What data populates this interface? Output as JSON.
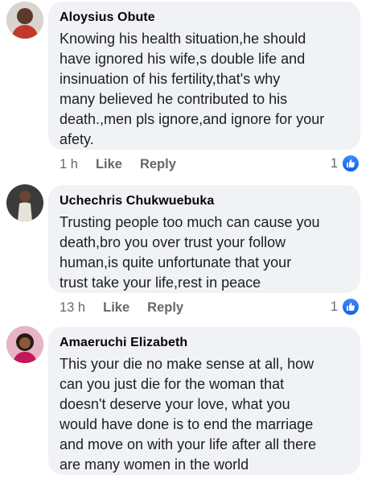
{
  "comments": [
    {
      "author": "Aloysius Obute",
      "text": "Knowing  his health situation,he should\nhave ignored his wife,s double life  and\ninsinuation  of his fertility,that's why\nmany believed he contributed to his\ndeath.,men pls ignore,and ignore for your\nafety.",
      "time": "1 h",
      "like_label": "Like",
      "reply_label": "Reply",
      "reaction_count": "1"
    },
    {
      "author": "Uchechris Chukwuebuka",
      "text": "Trusting people too much can cause you\ndeath,bro you over trust your follow\nhuman,is quite unfortunate that your\ntrust take your life,rest in peace",
      "time": "13 h",
      "like_label": "Like",
      "reply_label": "Reply",
      "reaction_count": "1"
    },
    {
      "author": "Amaeruchi Elizabeth",
      "text": "This your die no make sense at all, how\ncan you just die for the woman that\ndoesn't deserve your love, what you\nwould have done is to end the marriage\nand move on with your life after all there\nare many women in the world",
      "time": "",
      "like_label": "",
      "reply_label": "",
      "reaction_count": ""
    }
  ],
  "icons": {
    "avatar": "avatar",
    "like_reaction": "thumbs-up-icon"
  },
  "colors": {
    "bubble": "#f0f2f5",
    "action_text": "#65676b",
    "like_blue": "#1877f2"
  }
}
